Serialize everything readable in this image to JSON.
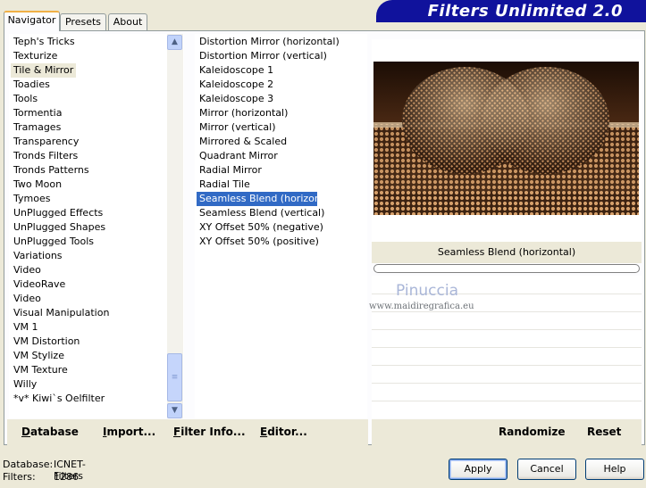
{
  "app": {
    "title": "Filters Unlimited 2.0"
  },
  "tabs": [
    {
      "label": "Navigator"
    },
    {
      "label": "Presets"
    },
    {
      "label": "About"
    }
  ],
  "categories": {
    "items": [
      "Teph's Tricks",
      "Texturize",
      "Tile & Mirror",
      "Toadies",
      "Tools",
      "Tormentia",
      "Tramages",
      "Transparency",
      "Tronds Filters",
      "Tronds Patterns",
      "Two Moon",
      "Tymoes",
      "UnPlugged Effects",
      "UnPlugged Shapes",
      "UnPlugged Tools",
      "Variations",
      "Video",
      "VideoRave",
      "Video",
      "Visual Manipulation",
      "VM 1",
      "VM Distortion",
      "VM Stylize",
      "VM Texture",
      "Willy",
      "*v* Kiwi`s Oelfilter"
    ],
    "selected": "Tile & Mirror"
  },
  "filters": {
    "items": [
      "Distortion Mirror (horizontal)",
      "Distortion Mirror (vertical)",
      "Kaleidoscope 1",
      "Kaleidoscope 2",
      "Kaleidoscope 3",
      "Mirror (horizontal)",
      "Mirror (vertical)",
      "Mirrored & Scaled",
      "Quadrant Mirror",
      "Radial Mirror",
      "Radial Tile",
      "Seamless Blend (horizontal)",
      "Seamless Blend (vertical)",
      "XY Offset 50% (negative)",
      "XY Offset 50% (positive)"
    ],
    "selected": "Seamless Blend (horizontal)"
  },
  "preview": {
    "filter_name": "Seamless Blend (horizontal)"
  },
  "watermark": {
    "name": "Pinuccia",
    "url": "www.maidiregrafica.eu"
  },
  "toolbar": {
    "database": "Database",
    "import": "Import...",
    "filter_info": "Filter Info...",
    "editor": "Editor...",
    "randomize": "Randomize",
    "reset": "Reset"
  },
  "status": {
    "database_label": "Database:",
    "database_value": "ICNET-Filters",
    "filters_label": "Filters:",
    "filters_value": "1286"
  },
  "buttons": {
    "apply": "Apply",
    "cancel": "Cancel",
    "help": "Help"
  },
  "colors": {
    "banner": "#10129c",
    "selection": "#316ac5",
    "tab_accent": "#f0b046"
  }
}
